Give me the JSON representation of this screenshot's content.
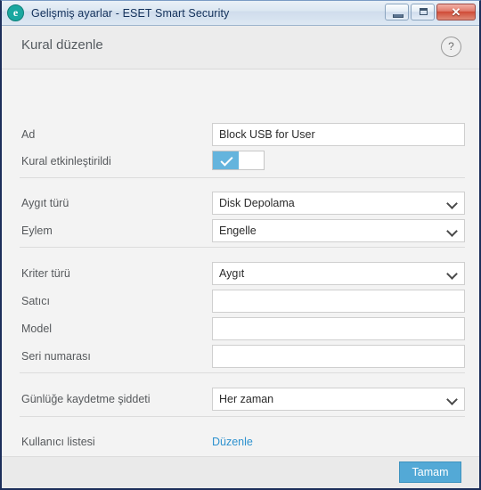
{
  "window": {
    "title": "Gelişmiş ayarlar - ESET Smart Security",
    "app_icon": "eset-logo-icon",
    "controls": {
      "minimize": "minimize-icon",
      "maximize": "maximize-icon",
      "close": "✕"
    }
  },
  "header": {
    "title": "Kural düzenle",
    "help": "?"
  },
  "form": {
    "name": {
      "label": "Ad",
      "value": "Block USB for User",
      "placeholder": ""
    },
    "rule_enabled": {
      "label": "Kural etkinleştirildi",
      "checked": true
    },
    "device_type": {
      "label": "Aygıt türü",
      "value": "Disk Depolama"
    },
    "action": {
      "label": "Eylem",
      "value": "Engelle"
    },
    "criteria_type": {
      "label": "Kriter türü",
      "value": "Aygıt"
    },
    "vendor": {
      "label": "Satıcı",
      "value": "",
      "placeholder": ""
    },
    "model": {
      "label": "Model",
      "value": "",
      "placeholder": ""
    },
    "serial_number": {
      "label": "Seri numarası",
      "value": "",
      "placeholder": ""
    },
    "logging_severity": {
      "label": "Günlüğe kaydetme şiddeti",
      "value": "Her zaman"
    },
    "user_list": {
      "label": "Kullanıcı listesi",
      "link": "Düzenle"
    }
  },
  "footer": {
    "ok_label": "Tamam"
  },
  "colors": {
    "accent": "#53a9d6",
    "toggle_on": "#64b4dd",
    "link": "#2e92cf",
    "title_text": "#12305a",
    "eset_teal": "#1aa7a0"
  }
}
